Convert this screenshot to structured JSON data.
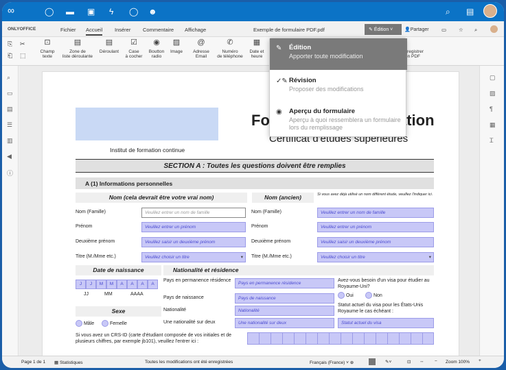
{
  "nextcloud": {
    "icons": [
      "logo-icon",
      "dashboard-icon",
      "files-icon",
      "photos-icon",
      "activity-icon",
      "search-app-icon",
      "contacts-icon"
    ]
  },
  "oo": {
    "brand": "ONLYOFFICE",
    "tabs": [
      "Fichier",
      "Accueil",
      "Insérer",
      "Commentaire",
      "Affichage"
    ],
    "doc_title": "Exemple de formulaire PDF.pdf",
    "mode_btn": "Édition",
    "share_btn": "Partager"
  },
  "ribbon": {
    "btns": [
      {
        "label": "Champ\ntexte"
      },
      {
        "label": "Zone de\nliste déroulante"
      },
      {
        "label": "Déroulant"
      },
      {
        "label": "Case\nà cocher"
      },
      {
        "label": "Boutton\nradio"
      },
      {
        "label": "Image"
      },
      {
        "label": "Adresse\nEmail"
      },
      {
        "label": "Numéro\nde téléphone"
      },
      {
        "label": "Date et\nheure"
      }
    ],
    "save_pdf": "Enregistrer\nen PDF"
  },
  "menu": {
    "items": [
      {
        "title": "Édition",
        "sub": "Apporter toute modification"
      },
      {
        "title": "Révision",
        "sub": "Proposer des modifications"
      },
      {
        "title": "Aperçu du formulaire",
        "sub": "Aperçu à quoi ressemblera un formulaire lors du remplissage"
      }
    ]
  },
  "doc": {
    "title_l": "Fo",
    "title_r": "ation",
    "subtitle": "Certificat d'études supérieures",
    "institute": "Institut de formation continue",
    "section": "SECTION A : Toutes les questions doivent être remplies",
    "personal": "A (1) Informations personnelles",
    "nom_vrai": "Nom (cela devrait être votre vrai nom)",
    "nom_ancien": "Nom (ancien)",
    "ancien_note": "Si vous avez déjà utilisé un nom différent étude, veuillez l'indiquer ici.",
    "row_labels": [
      "Nom (Famille)",
      "Prénom",
      "Deuxième prénom",
      "Titre (M./Mme etc.)"
    ],
    "ph": [
      "Veuillez entrer un nom de famille",
      "Veuillez entrer un prénom",
      "Veuillez saisir un deuxième prénom",
      "Veuillez choisir un titre"
    ],
    "dob": "Date de naissance",
    "dob_cells": [
      "J",
      "J",
      "M",
      "M",
      "A",
      "A",
      "A",
      "A"
    ],
    "dob_labels": [
      "JJ",
      "MM",
      "AAAA"
    ],
    "nat": "Nationalité et résidence",
    "nat_labels": [
      "Pays en permanence résidence",
      "Pays de naissance",
      "Nationalité",
      "Une nationalité sur deux"
    ],
    "nat_ph": [
      "Pays en permanence résidence",
      "Pays de naissance",
      "Nationalité",
      "Une nationalité sur deux"
    ],
    "visa_q": "Avez-vous besoin d'un visa pour étudier au Royaume-Uni?",
    "oui": "Oui",
    "non": "Non",
    "visa_status": "Statut actuel du visa pour les États-Unis Royaume le cas échéant :",
    "visa_ph": "Statut actuel du visa",
    "sexe": "Sexe",
    "male": "Mâle",
    "femelle": "Femelle",
    "crsid": "Si vous avez un CRS-ID (carte d'étudiant composée de vos initiales et de plusieurs chiffres, par exemple jb101), veuillez l'entrer ici :"
  },
  "status": {
    "page": "Page 1 de 1",
    "stats": "Statistiques",
    "saved": "Toutes les modifications ont été enregistrées",
    "lang": "Français (France)",
    "zoom": "Zoom 100%"
  }
}
